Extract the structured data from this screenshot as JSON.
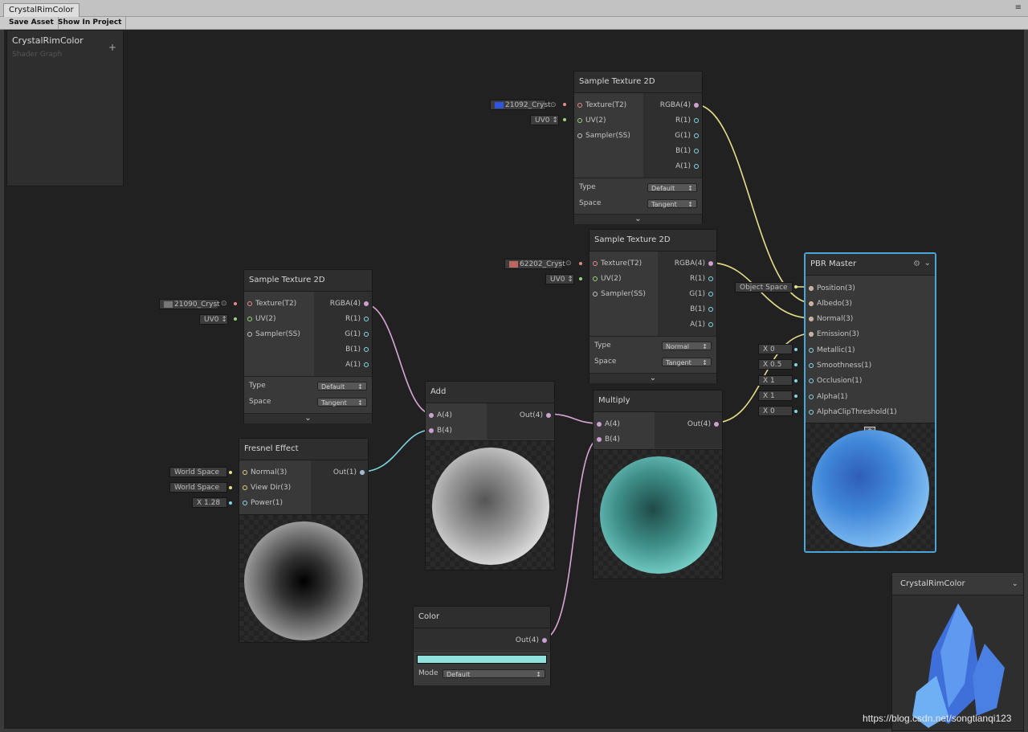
{
  "window": {
    "tab_title": "CrystalRimColor",
    "tab_menu": "≡"
  },
  "toolbar": {
    "save_asset": "Save Asset",
    "show_in_project": "Show In Project"
  },
  "blackboard": {
    "title": "CrystalRimColor",
    "subtitle": "Shader Graph",
    "add": "+"
  },
  "nodes": {
    "tex1": {
      "title": "Sample Texture 2D",
      "inputs": [
        "Texture(T2)",
        "UV(2)",
        "Sampler(SS)"
      ],
      "outputs": [
        "RGBA(4)",
        "R(1)",
        "G(1)",
        "B(1)",
        "A(1)"
      ],
      "type_label": "Type",
      "type_value": "Default",
      "space_label": "Space",
      "space_value": "Tangent",
      "tex_chip": "21092_Cryst",
      "uv_chip": "UV0"
    },
    "tex2": {
      "title": "Sample Texture 2D",
      "inputs": [
        "Texture(T2)",
        "UV(2)",
        "Sampler(SS)"
      ],
      "outputs": [
        "RGBA(4)",
        "R(1)",
        "G(1)",
        "B(1)",
        "A(1)"
      ],
      "type_label": "Type",
      "type_value": "Normal",
      "space_label": "Space",
      "space_value": "Tangent",
      "tex_chip": "62202_Cryst",
      "uv_chip": "UV0"
    },
    "tex3": {
      "title": "Sample Texture 2D",
      "inputs": [
        "Texture(T2)",
        "UV(2)",
        "Sampler(SS)"
      ],
      "outputs": [
        "RGBA(4)",
        "R(1)",
        "G(1)",
        "B(1)",
        "A(1)"
      ],
      "type_label": "Type",
      "type_value": "Default",
      "space_label": "Space",
      "space_value": "Tangent",
      "tex_chip": "21090_Cryst",
      "uv_chip": "UV0"
    },
    "fresnel": {
      "title": "Fresnel Effect",
      "inputs": [
        "Normal(3)",
        "View Dir(3)",
        "Power(1)"
      ],
      "output": "Out(1)",
      "chips": [
        "World Space",
        "World Space",
        "X 1.28"
      ]
    },
    "add": {
      "title": "Add",
      "inputs": [
        "A(4)",
        "B(4)"
      ],
      "output": "Out(4)"
    },
    "multiply": {
      "title": "Multiply",
      "inputs": [
        "A(4)",
        "B(4)"
      ],
      "output": "Out(4)"
    },
    "color": {
      "title": "Color",
      "output": "Out(4)",
      "mode_label": "Mode",
      "mode_value": "Default",
      "swatch": "#8fe3dc"
    },
    "pbr": {
      "title": "PBR Master",
      "inputs": [
        "Position(3)",
        "Albedo(3)",
        "Normal(3)",
        "Emission(3)",
        "Metallic(1)",
        "Smoothness(1)",
        "Occlusion(1)",
        "Alpha(1)",
        "AlphaClipThreshold(1)"
      ],
      "chips": [
        "Object Space",
        "X 0",
        "X 0.5",
        "X 1",
        "X 1",
        "X 0"
      ]
    }
  },
  "main_preview": {
    "title": "CrystalRimColor"
  },
  "watermark": "https://blog.csdn.net/songtianqi123",
  "colors": {
    "selected_border": "#4aa6d9",
    "wire_pink": "#d9a6d4",
    "wire_yellow": "#e6e08a",
    "wire_cyan": "#7fd6e0"
  }
}
